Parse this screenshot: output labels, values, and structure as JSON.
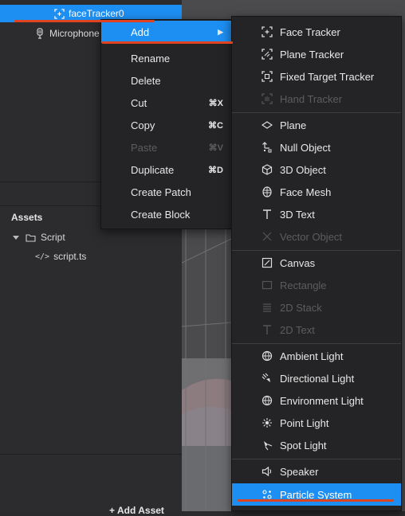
{
  "scene": {
    "selected_item": "faceTracker0",
    "microphone_item": "Microphone"
  },
  "assets": {
    "title": "Assets",
    "folder": "Script",
    "file": "script.ts",
    "add_button": "Add Asset"
  },
  "context_menu": {
    "add": "Add",
    "add_arrow": "▶",
    "rename": "Rename",
    "delete": "Delete",
    "cut": "Cut",
    "cut_shortcut": "⌘X",
    "copy": "Copy",
    "copy_shortcut": "⌘C",
    "paste": "Paste",
    "paste_shortcut": "⌘V",
    "duplicate": "Duplicate",
    "duplicate_shortcut": "⌘D",
    "create_patch": "Create Patch",
    "create_block": "Create Block"
  },
  "add_submenu": {
    "face_tracker": "Face Tracker",
    "plane_tracker": "Plane Tracker",
    "fixed_target_tracker": "Fixed Target Tracker",
    "hand_tracker": "Hand Tracker",
    "plane": "Plane",
    "null_object": "Null Object",
    "object_3d": "3D Object",
    "face_mesh": "Face Mesh",
    "text_3d": "3D Text",
    "vector_object": "Vector Object",
    "canvas": "Canvas",
    "rectangle": "Rectangle",
    "stack_2d": "2D Stack",
    "text_2d": "2D Text",
    "ambient_light": "Ambient Light",
    "directional_light": "Directional Light",
    "environment_light": "Environment Light",
    "point_light": "Point Light",
    "spot_light": "Spot Light",
    "speaker": "Speaker",
    "particle_system": "Particle System"
  },
  "colors": {
    "highlight": "#1d8ff2",
    "annotation": "#e0431f",
    "menu_bg": "#242426"
  }
}
